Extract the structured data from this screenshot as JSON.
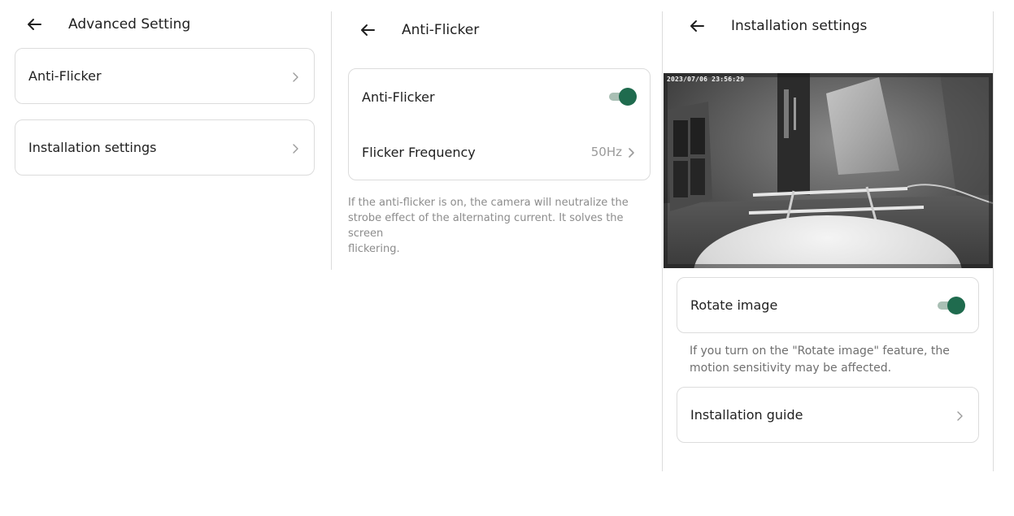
{
  "panel1": {
    "title": "Advanced Setting",
    "items": [
      {
        "label": "Anti-Flicker"
      },
      {
        "label": "Installation settings"
      }
    ]
  },
  "panel2": {
    "title": "Anti-Flicker",
    "anti_flicker_label": "Anti-Flicker",
    "anti_flicker_on": true,
    "frequency_label": "Flicker Frequency",
    "frequency_value": "50Hz",
    "note_line1": "If the anti-flicker is on, the camera will neutralize the",
    "note_line2": "strobe effect of the alternating current. It solves the screen",
    "note_line3": "flickering."
  },
  "panel3": {
    "title": "Installation settings",
    "timestamp": "2023/07/06 23:56:29",
    "rotate_label": "Rotate image",
    "rotate_on": true,
    "rotate_note_line1": "If you turn on the \"Rotate image\" feature, the",
    "rotate_note_line2": "motion sensitivity may be affected.",
    "guide_label": "Installation guide"
  },
  "colors": {
    "toggle_on": "#1f6b4e",
    "toggle_track": "#a9bfb4",
    "card_border": "#dcdcdc",
    "muted_text": "#8c8c8c"
  },
  "icons": {
    "back": "arrow-left-icon",
    "chevron": "chevron-right-icon"
  }
}
